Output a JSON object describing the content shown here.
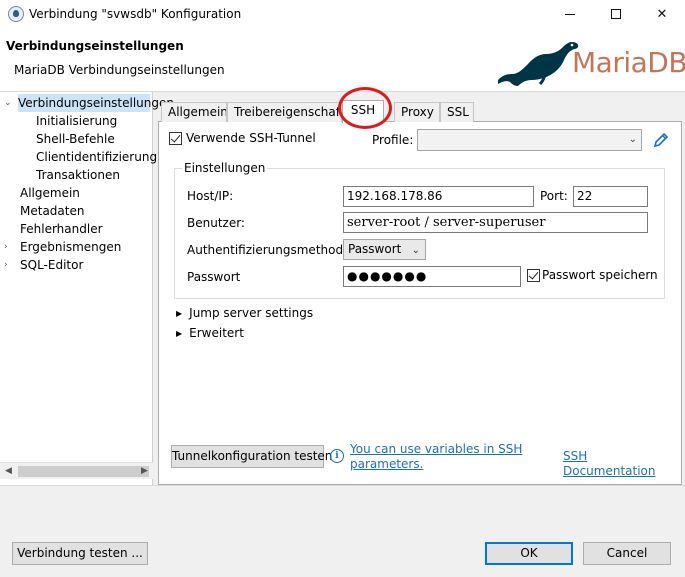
{
  "window": {
    "title": "Verbindung \"svwsdb\" Konfiguration",
    "minimize": "minimize",
    "maximize": "maximize",
    "close": "close"
  },
  "header": {
    "title": "Verbindungseinstellungen",
    "subtitle": "MariaDB Verbindungseinstellungen",
    "logo_text": "MariaDB",
    "logo_color": "#c0765a"
  },
  "sidebar": {
    "items": [
      {
        "label": "Verbindungseinstellungen",
        "level": 0,
        "expanded": true,
        "selected": true
      },
      {
        "label": "Initialisierung",
        "level": 1
      },
      {
        "label": "Shell-Befehle",
        "level": 1
      },
      {
        "label": "Clientidentifizierung",
        "level": 1
      },
      {
        "label": "Transaktionen",
        "level": 1
      },
      {
        "label": "Allgemein",
        "level": 0
      },
      {
        "label": "Metadaten",
        "level": 0
      },
      {
        "label": "Fehlerhandler",
        "level": 0
      },
      {
        "label": "Ergebnismengen",
        "level": 0,
        "expandable": true
      },
      {
        "label": "SQL-Editor",
        "level": 0,
        "expandable": true
      }
    ]
  },
  "tabs": {
    "items": [
      "Allgemein",
      "Treibereigenschaften",
      "SSH",
      "Proxy",
      "SSL"
    ],
    "active": "SSH",
    "highlight_color": "#e0181c"
  },
  "ssh": {
    "use_tunnel_label": "Verwende SSH-Tunnel",
    "use_tunnel_checked": true,
    "profile_label": "Profile:",
    "profile_value": "",
    "settings_legend": "Einstellungen",
    "host_label": "Host/IP:",
    "host_value": "192.168.178.86",
    "port_label": "Port:",
    "port_value": "22",
    "user_label": "Benutzer:",
    "user_value": "server-root / server-superuser",
    "auth_label": "Authentifizierungsmethode:",
    "auth_value": "Passwort",
    "password_label": "Passwort",
    "password_value": "●●●●●●●",
    "save_password_label": "Passwort speichern",
    "save_password_checked": true,
    "jump_server_label": "Jump server settings",
    "advanced_label": "Erweitert",
    "test_tunnel_label": "Tunnelkonfiguration testen",
    "variables_link": "You can use variables in SSH parameters.",
    "variables_link_line1": "You can use variables in SSH",
    "variables_link_line2": "parameters.",
    "docs_link": "SSH Documentation"
  },
  "footer": {
    "test_connection_label": "Verbindung testen ...",
    "ok_label": "OK",
    "cancel_label": "Cancel"
  }
}
